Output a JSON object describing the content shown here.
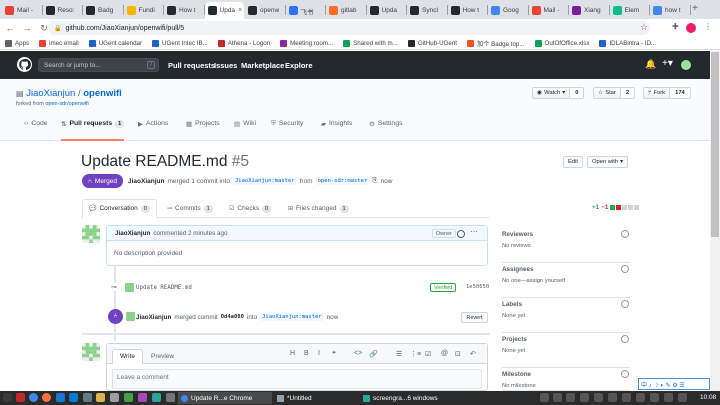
{
  "browser": {
    "tabs": [
      {
        "label": "Mail -",
        "color": "#ea4335"
      },
      {
        "label": "Reso:",
        "color": "#24292e"
      },
      {
        "label": "Badg",
        "color": "#24292e"
      },
      {
        "label": "Fundi",
        "color": "#f7b500"
      },
      {
        "label": "How t",
        "color": "#24292e"
      },
      {
        "label": "Upda",
        "color": "#24292e",
        "active": true
      },
      {
        "label": "openw",
        "color": "#24292e"
      },
      {
        "label": "飞书",
        "color": "#3370ff"
      },
      {
        "label": "gitlab",
        "color": "#fc6d26"
      },
      {
        "label": "Upda",
        "color": "#24292e"
      },
      {
        "label": "Syncl",
        "color": "#24292e"
      },
      {
        "label": "How t",
        "color": "#24292e"
      },
      {
        "label": "Goog",
        "color": "#4285f4"
      },
      {
        "label": "Mail -",
        "color": "#ea4335"
      },
      {
        "label": "Xiang",
        "color": "#7b1fa2"
      },
      {
        "label": "Elem",
        "color": "#0dbd8b"
      },
      {
        "label": "how t",
        "color": "#4285f4"
      }
    ],
    "close_glyph": "×",
    "new_tab_glyph": "+",
    "url": "github.com/JiaoXianjun/openwifi/pull/5",
    "nav": {
      "back": "←",
      "forward": "→",
      "reload": "↻"
    },
    "bookmarks": [
      {
        "label": "Apps",
        "color": "#5f6368"
      },
      {
        "label": "imec email",
        "color": "#ea4335"
      },
      {
        "label": "UGent calendar",
        "color": "#1e64c8"
      },
      {
        "label": "UGent Intec IB...",
        "color": "#1e64c8"
      },
      {
        "label": "Athena - Logon",
        "color": "#c62828"
      },
      {
        "label": "Meeting room...",
        "color": "#8e24aa"
      },
      {
        "label": "Shared with m...",
        "color": "#0f9d58"
      },
      {
        "label": "GitHub-UGent",
        "color": "#24292e"
      },
      {
        "label": "加个 Badge top...",
        "color": "#f4511e"
      },
      {
        "label": "OutOfOffice.xlsx",
        "color": "#0f9d58"
      },
      {
        "label": "IDLABintra - ID...",
        "color": "#1e64c8"
      }
    ]
  },
  "github": {
    "search_placeholder": "Search or jump to...",
    "search_slash": "/",
    "nav": [
      "Pull requests",
      "Issues",
      "Marketplace",
      "Explore"
    ],
    "header_icons": {
      "bell": "bell-icon",
      "plus": "plus-icon",
      "avatar": "avatar-icon"
    }
  },
  "repo": {
    "owner": "JiaoXianjun",
    "sep": "/",
    "name": "openwifi",
    "forked_prefix": "forked from",
    "forked_from": "open-sdr/openwifi",
    "watch": {
      "label": "Watch",
      "count": "0"
    },
    "star": {
      "label": "Star",
      "count": "2"
    },
    "fork": {
      "label": "Fork",
      "count": "174"
    },
    "tabs": [
      {
        "label": "Code",
        "icon": "code-icon"
      },
      {
        "label": "Pull requests",
        "count": "1",
        "selected": true,
        "icon": "pull-request-icon"
      },
      {
        "label": "Actions",
        "icon": "actions-icon"
      },
      {
        "label": "Projects",
        "icon": "projects-icon"
      },
      {
        "label": "Wiki",
        "icon": "wiki-icon"
      },
      {
        "label": "Security",
        "icon": "shield-icon"
      },
      {
        "label": "Insights",
        "icon": "graph-icon"
      },
      {
        "label": "Settings",
        "icon": "gear-icon"
      }
    ]
  },
  "pr": {
    "title": "Update README.md",
    "number": "#5",
    "edit": "Edit",
    "open_with": "Open with",
    "status": "Merged",
    "author": "JiaoXianjun",
    "merge_text_1": "merged 1 commit into",
    "target_branch": "JiaoXianjun:master",
    "merge_text_2": "from",
    "source_branch": "open-sdr:master",
    "when": "now",
    "tabs": [
      {
        "label": "Conversation",
        "count": "0",
        "selected": true
      },
      {
        "label": "Commits",
        "count": "1"
      },
      {
        "label": "Checks",
        "count": "0"
      },
      {
        "label": "Files changed",
        "count": "1"
      }
    ],
    "diffstat": {
      "add": "+1",
      "del": "−1",
      "colors": [
        "#28a745",
        "#cb2431",
        "#d1d5da",
        "#d1d5da",
        "#d1d5da"
      ]
    }
  },
  "comment": {
    "author": "JiaoXianjun",
    "action": "commented 2 minutes ago",
    "badge": "Owner",
    "body": "No description provided"
  },
  "commit": {
    "message": "Update README.md",
    "verified": "Verified",
    "sha": "1e50650"
  },
  "merge_event": {
    "author": "JiaoXianjun",
    "text": "merged commit",
    "sha": "0d4a080",
    "into": "into",
    "branch": "JiaoXianjun:master",
    "when": "now",
    "revert": "Revert"
  },
  "new_comment": {
    "write_tab": "Write",
    "preview_tab": "Preview",
    "placeholder": "Leave a comment",
    "tools": [
      "H",
      "B",
      "I",
      "❝",
      "<>",
      "🔗",
      "☰",
      "⋮≡",
      "☑",
      "@",
      "⊡",
      "↶"
    ]
  },
  "sidebar": [
    {
      "title": "Reviewers",
      "value": "No reviews"
    },
    {
      "title": "Assignees",
      "value": "No one—assign yourself"
    },
    {
      "title": "Labels",
      "value": "None yet"
    },
    {
      "title": "Projects",
      "value": "None yet"
    },
    {
      "title": "Milestone",
      "value": "No milestone"
    }
  ],
  "taskbar": {
    "items": [
      "Update R...e Chrome",
      "*Untitled",
      "screengra...6 windows"
    ],
    "clock": "10:08",
    "ime": "中 ♪ ☽ ◐ ✎ ⚙ ☰"
  }
}
